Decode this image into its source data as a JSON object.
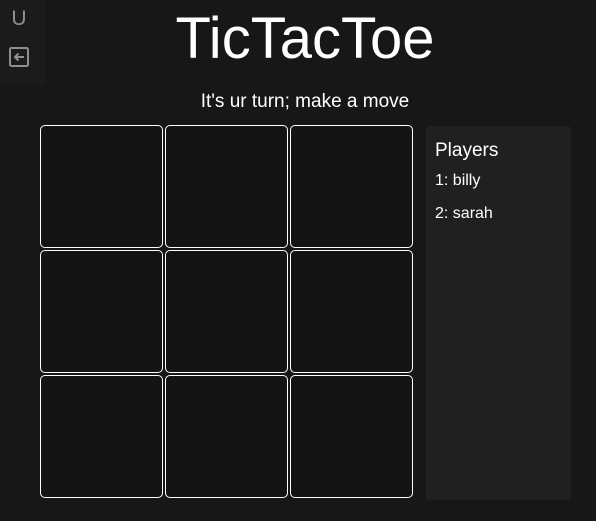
{
  "rail": {
    "letter": "U",
    "exit_icon": "exit-icon"
  },
  "title": "TicTacToe",
  "status": "It's ur turn; make a move",
  "board": {
    "cells": [
      "",
      "",
      "",
      "",
      "",
      "",
      "",
      "",
      ""
    ]
  },
  "players": {
    "title": "Players",
    "list": [
      "1: billy",
      "2: sarah"
    ]
  }
}
